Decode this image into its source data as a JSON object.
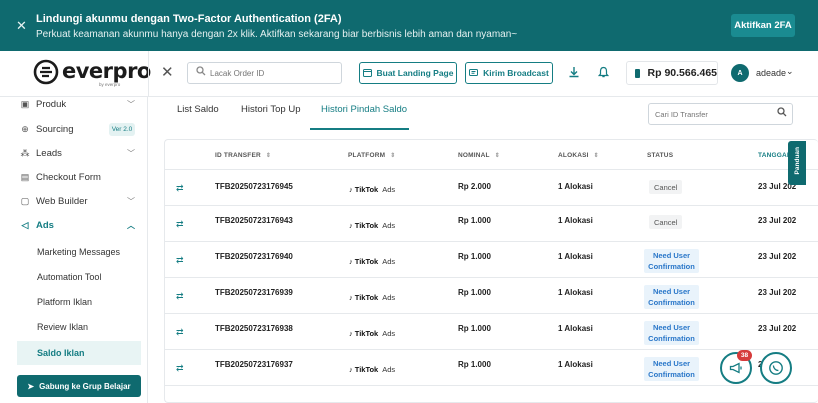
{
  "banner": {
    "title": "Lindungi akunmu dengan Two-Factor Authentication (2FA)",
    "subtitle": "Perkuat keamanan akunmu hanya dengan 2x klik. Aktifkan sekarang biar berbisnis lebih aman dan nyaman~",
    "cta": "Aktifkan 2FA"
  },
  "header": {
    "logo": "everpro",
    "logo_sub": "by everpro",
    "search_placeholder": "Lacak Order ID",
    "landing_button": "Buat Landing Page",
    "broadcast_button": "Kirim Broadcast",
    "balance": "Rp 90.566.465",
    "avatar_initial": "A",
    "username": "adeade"
  },
  "sidebar": {
    "items": [
      {
        "label": "Produk"
      },
      {
        "label": "Sourcing",
        "badge": "Ver 2.0"
      },
      {
        "label": "Leads"
      },
      {
        "label": "Checkout Form"
      },
      {
        "label": "Web Builder"
      },
      {
        "label": "Ads"
      }
    ],
    "sub_items": [
      {
        "label": "Marketing Messages"
      },
      {
        "label": "Automation Tool"
      },
      {
        "label": "Platform Iklan"
      },
      {
        "label": "Review Iklan"
      },
      {
        "label": "Saldo Iklan"
      }
    ],
    "join_button": "Gabung ke Grup Belajar"
  },
  "tabs": [
    {
      "label": "List Saldo"
    },
    {
      "label": "Histori Top Up"
    },
    {
      "label": "Histori Pindah Saldo"
    }
  ],
  "transfer_search_placeholder": "Cari ID Transfer",
  "table": {
    "headers": {
      "id": "ID TRANSFER",
      "platform": "PLATFORM",
      "nominal": "NOMINAL",
      "alokasi": "ALOKASI",
      "status": "STATUS",
      "tanggal": "TANGGAL"
    },
    "rows": [
      {
        "id": "TFB20250723176945",
        "platform": "TikTok",
        "platform_suffix": "Ads",
        "nominal": "Rp 2.000",
        "alokasi": "1 Alokasi",
        "status": "Cancel",
        "date": "23 Jul 202"
      },
      {
        "id": "TFB20250723176943",
        "platform": "TikTok",
        "platform_suffix": "Ads",
        "nominal": "Rp 1.000",
        "alokasi": "1 Alokasi",
        "status": "Cancel",
        "date": "23 Jul 202"
      },
      {
        "id": "TFB20250723176940",
        "platform": "TikTok",
        "platform_suffix": "Ads",
        "nominal": "Rp 1.000",
        "alokasi": "1 Alokasi",
        "status_line1": "Need User",
        "status_line2": "Confirmation",
        "date": "23 Jul 202"
      },
      {
        "id": "TFB20250723176939",
        "platform": "TikTok",
        "platform_suffix": "Ads",
        "nominal": "Rp 1.000",
        "alokasi": "1 Alokasi",
        "status_line1": "Need User",
        "status_line2": "Confirmation",
        "date": "23 Jul 202"
      },
      {
        "id": "TFB20250723176938",
        "platform": "TikTok",
        "platform_suffix": "Ads",
        "nominal": "Rp 1.000",
        "alokasi": "1 Alokasi",
        "status_line1": "Need User",
        "status_line2": "Confirmation",
        "date": "23 Jul 202"
      },
      {
        "id": "TFB20250723176937",
        "platform": "TikTok",
        "platform_suffix": "Ads",
        "nominal": "Rp 1.000",
        "alokasi": "1 Alokasi",
        "status_line1": "Need User",
        "status_line2": "Confirmation",
        "date": "2"
      }
    ]
  },
  "side_tab": "Panduan",
  "notif_badge": "38",
  "colors": {
    "brand": "#0f6a6f",
    "accent": "#157d83",
    "info": "#2a77c9",
    "danger": "#d63b3b"
  }
}
